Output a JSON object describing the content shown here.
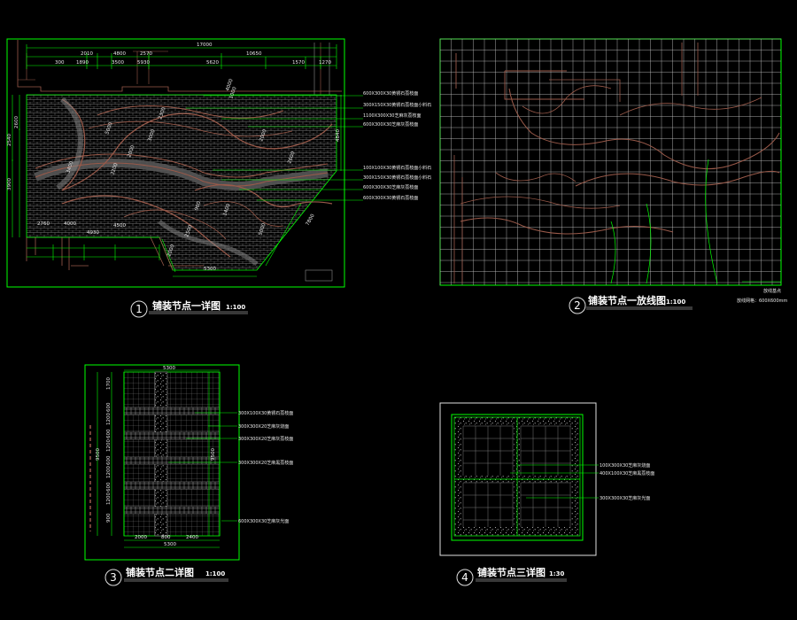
{
  "colors": {
    "background": "#000000",
    "frame": "#00ff00",
    "paving": "#808080",
    "contour": "#9a5a4a",
    "text": "#ffffff"
  },
  "views": [
    {
      "number": "1",
      "title": "铺装节点一详图",
      "scale": "1:100",
      "dims_top": [
        "17000"
      ],
      "dims_second": [
        "2010",
        "4800",
        "2570",
        "10650"
      ],
      "dims_third": [
        "300",
        "1890",
        "3500",
        "5930",
        "5620",
        "1570",
        "1270"
      ],
      "dims_left": [
        "2600",
        "2540",
        "3900"
      ],
      "dims_bottom": [
        "2760",
        "4000",
        "4930",
        "4500",
        "5300",
        "7800"
      ],
      "dims_right": [
        "4840"
      ],
      "rotated_dims": [
        "5000",
        "2000",
        "3000",
        "2300",
        "3200",
        "3400",
        "2000",
        "2600",
        "1000",
        "1400",
        "2500",
        "900",
        "4000",
        "5000",
        "2000"
      ],
      "annotations": [
        "600X300X30黄锈石荔枝面",
        "300X150X30黄锈石荔枝面小料石",
        "1100X300X30芝麻灰荔枝面",
        "600X300X30芝麻灰荔枝面",
        "100X100X30黄锈石荔枝面小料石",
        "300X150X30黄锈石荔枝面小料石",
        "600X300X30芝麻灰荔枝面",
        "600X300X30黄锈石荔枝面"
      ]
    },
    {
      "number": "2",
      "title": "铺装节点一放线图",
      "scale": "1:100",
      "legend": [
        "放线基点",
        "放线网格：600X600mm"
      ]
    },
    {
      "number": "3",
      "title": "铺装节点二详图",
      "scale": "1:100",
      "dims_top": [
        "5300"
      ],
      "dims_left": [
        "1700",
        "600",
        "1200",
        "600",
        "1200",
        "600",
        "1200",
        "600",
        "1200",
        "900"
      ],
      "dims_left_total": [
        "9500"
      ],
      "dims_mid": [
        "9500"
      ],
      "dims_bottom": [
        "2000",
        "800",
        "2400"
      ],
      "dims_bottom_total": [
        "5300"
      ],
      "annotations": [
        "300X100X30黄锈石荔枝面",
        "300X300X20芝麻灰烧面",
        "300X300X20芝麻灰荔枝面",
        "300X300X20芝麻黑荔枝面",
        "600X300X30芝麻灰光面"
      ]
    },
    {
      "number": "4",
      "title": "铺装节点三详图",
      "scale": "1:30",
      "annotations": [
        "100X300X30芝麻灰烧面",
        "400X100X30芝麻黑荔枝面",
        "300X300X30芝麻灰光面"
      ]
    }
  ]
}
